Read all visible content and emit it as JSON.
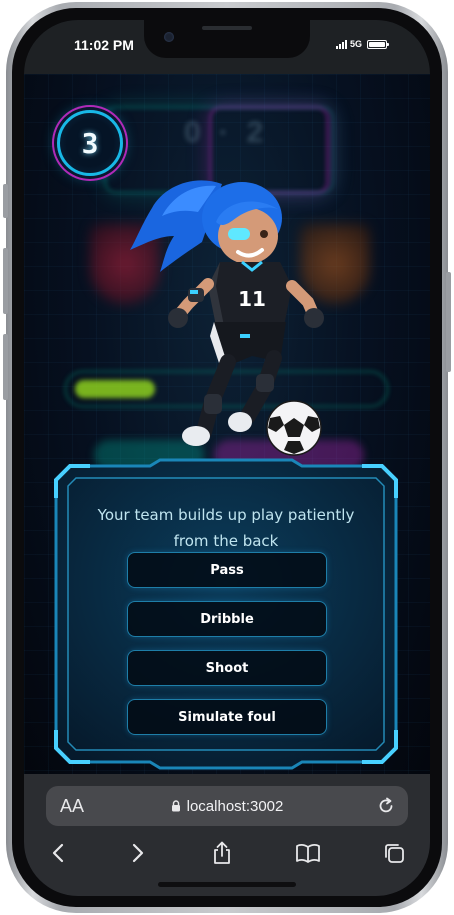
{
  "status_bar": {
    "time": "11:02 PM",
    "network": "5G"
  },
  "game": {
    "round_number": "3",
    "question": "Your team builds up play patiently from the back",
    "answers": [
      {
        "label": "Pass"
      },
      {
        "label": "Dribble"
      },
      {
        "label": "Shoot"
      },
      {
        "label": "Simulate foul"
      }
    ]
  },
  "browser": {
    "text_size_label": "AA",
    "url": "localhost:3002"
  },
  "icons": {
    "lock": "lock-icon",
    "reload": "reload-icon",
    "back": "back-icon",
    "forward": "forward-icon",
    "share": "share-icon",
    "bookmarks": "bookmarks-icon",
    "tabs": "tabs-icon"
  },
  "colors": {
    "accent_cyan": "#18b8e6",
    "accent_magenta": "#b02ab8",
    "panel_border": "#1e8fc0",
    "question_text": "#bfe4ef",
    "browser_bar": "#2b2d31"
  }
}
